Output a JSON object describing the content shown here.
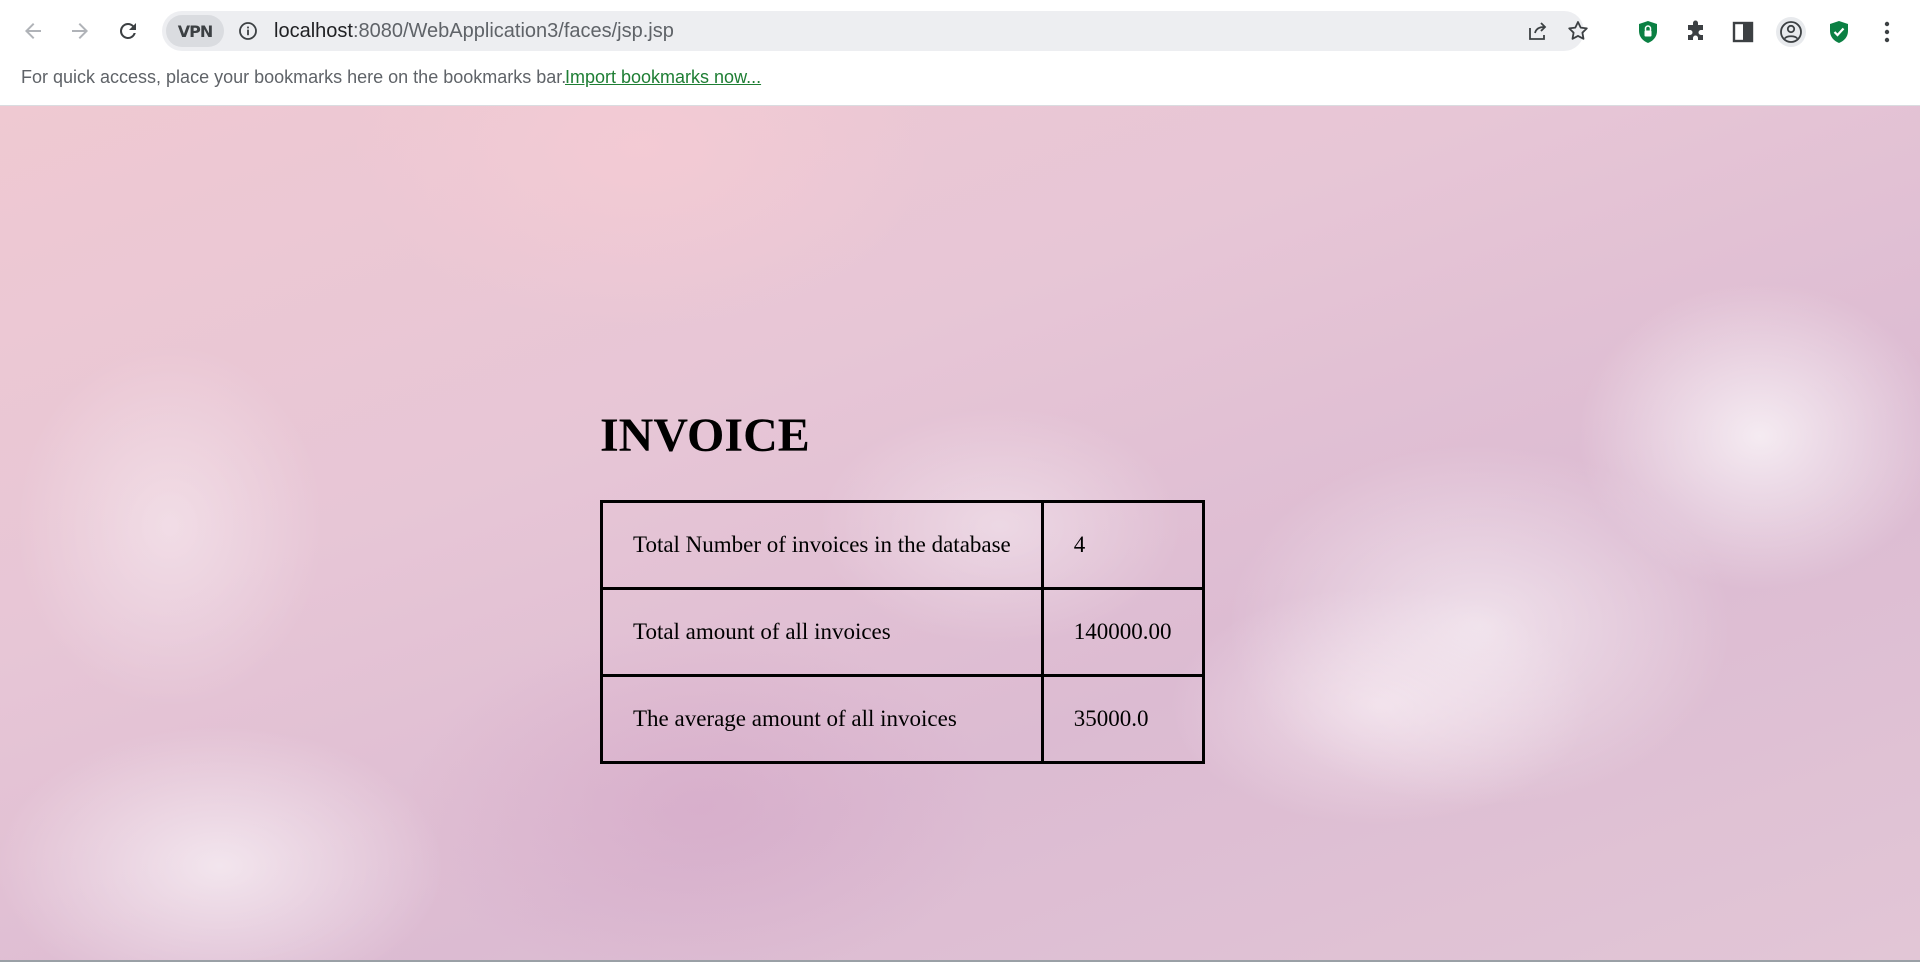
{
  "browser": {
    "address_bar": {
      "vpn_label": "VPN",
      "url_host": "localhost",
      "url_rest": ":8080/WebApplication3/faces/jsp.jsp"
    },
    "bookmarks_bar": {
      "hint": "For quick access, place your bookmarks here on the bookmarks bar.",
      "import_link": "Import bookmarks now..."
    },
    "colors": {
      "link": "#1e7e34",
      "extension_shield": "#0b8043"
    }
  },
  "page": {
    "title": "INVOICE",
    "rows": [
      {
        "label": "Total Number of invoices in the database",
        "value": "4"
      },
      {
        "label": "Total amount of all invoices",
        "value": "140000.00"
      },
      {
        "label": "The average amount of all invoices",
        "value": "35000.0"
      }
    ]
  }
}
